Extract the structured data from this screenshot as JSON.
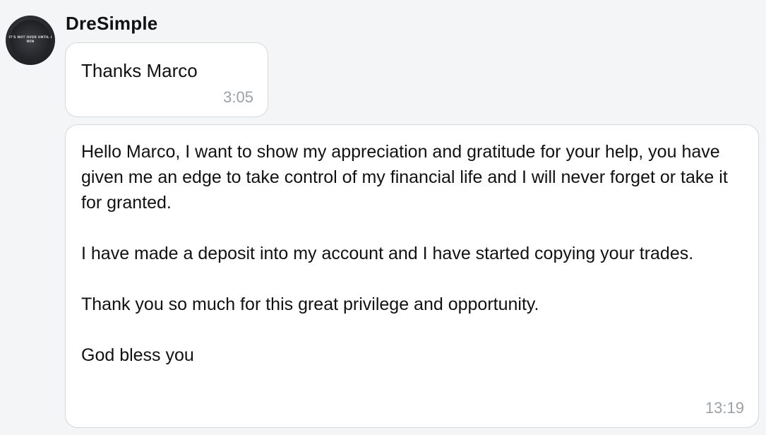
{
  "message_group": {
    "sender": "DreSimple",
    "messages": [
      {
        "text": "Thanks Marco",
        "time": "3:05"
      },
      {
        "paragraphs": [
          "Hello Marco, I want to show my appreciation and gratitude for your help, you have given me an edge to take control of my financial life and I will never forget or take it for granted.",
          "I have made a deposit into my account and I have started copying your trades.",
          "Thank you so much for this great privilege and opportunity.",
          "God bless you"
        ],
        "time": "13:19"
      }
    ]
  },
  "avatar": {
    "text": "IT'S NOT OVER UNTIL I WIN"
  }
}
